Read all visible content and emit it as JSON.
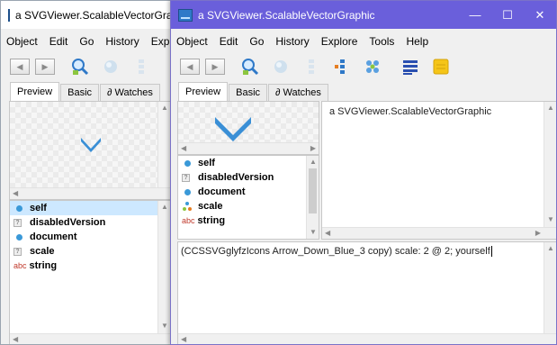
{
  "back_window": {
    "title": "a SVGViewer.ScalableVectorGraphic",
    "menu": [
      "Object",
      "Edit",
      "Go",
      "History",
      "Explo"
    ],
    "tabs": [
      "Preview",
      "Basic",
      "∂ Watches"
    ],
    "fields": [
      {
        "label": "self",
        "icon": "dot",
        "selected": true
      },
      {
        "label": "disabledVersion",
        "icon": "square",
        "selected": false
      },
      {
        "label": "document",
        "icon": "dot",
        "selected": false
      },
      {
        "label": "scale",
        "icon": "square",
        "selected": false
      },
      {
        "label": "string",
        "icon": "abc",
        "selected": false
      }
    ]
  },
  "front_window": {
    "title": "a SVGViewer.ScalableVectorGraphic",
    "controls": {
      "minimize": "—",
      "maximize": "☐",
      "close": "✕"
    },
    "menu": [
      "Object",
      "Edit",
      "Go",
      "History",
      "Explore",
      "Tools",
      "Help"
    ],
    "tabs": [
      "Preview",
      "Basic",
      "∂ Watches"
    ],
    "fields": [
      {
        "label": "self",
        "icon": "dot",
        "selected": false
      },
      {
        "label": "disabledVersion",
        "icon": "square",
        "selected": false
      },
      {
        "label": "document",
        "icon": "dot",
        "selected": false
      },
      {
        "label": "scale",
        "icon": "multi",
        "selected": false
      },
      {
        "label": "string",
        "icon": "abc",
        "selected": false
      }
    ],
    "value_text": "a SVGViewer.ScalableVectorGraphic",
    "workspace_text": "(CCSSVGglyfzIcons Arrow_Down_Blue_3 copy) scale: 2 @ 2; yourself"
  },
  "icons": {
    "abc": "abc",
    "square": "?"
  },
  "colors": {
    "title_active": "#6a5fdb",
    "chevron": "#3a8fd6",
    "selection": "#cde8ff"
  }
}
